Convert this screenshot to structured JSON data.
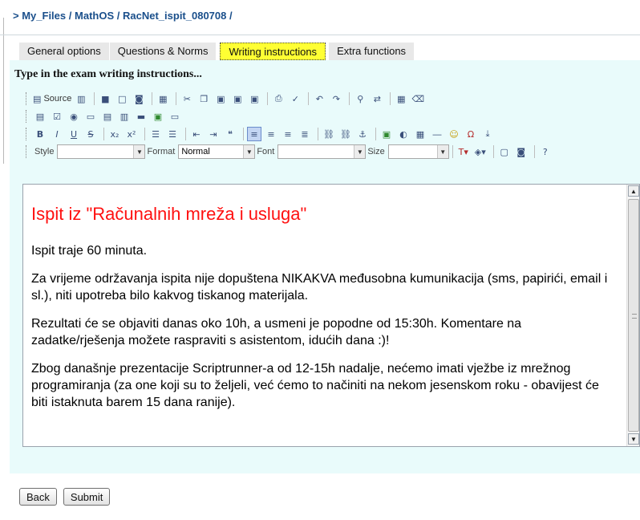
{
  "breadcrumb": {
    "prefix": ">",
    "items": [
      "My_Files",
      "MathOS",
      "RacNet_ispit_080708"
    ],
    "sep": "/"
  },
  "tabs": [
    {
      "label": "General options",
      "active": false
    },
    {
      "label": "Questions & Norms",
      "active": false
    },
    {
      "label": "Writing instructions",
      "active": true
    },
    {
      "label": "Extra functions",
      "active": false
    }
  ],
  "panel": {
    "title": "Type in the exam writing instructions..."
  },
  "toolbar": {
    "source_label": "Source",
    "style_label": "Style",
    "style_value": "",
    "format_label": "Format",
    "format_value": "Normal",
    "font_label": "Font",
    "font_value": "",
    "size_label": "Size",
    "size_value": ""
  },
  "editor": {
    "heading": "Ispit iz \"Računalnih mreža i usluga\"",
    "paragraphs": [
      "Ispit  traje 60 minuta.",
      "Za vrijeme održavanja ispita nije dopuštena NIKAKVA međusobna kumunikacija (sms, papirići, email i sl.), niti upotreba bilo kakvog tiskanog materijala.",
      "Rezultati će se objaviti danas oko 10h, a usmeni je popodne od 15:30h. Komentare na zadatke/rješenja možete raspraviti s asistentom, idućih dana :)!",
      "Zbog današnje prezentacije Scriptrunner-a od 12-15h nadalje, nećemo imati vježbe iz mrežnog programiranja (za one koji su to željeli, već ćemo to načiniti na nekom jesenskom roku - obavijest će  biti istaknuta barem 15 dana ranije)."
    ]
  },
  "buttons": {
    "back": "Back",
    "submit": "Submit"
  },
  "colors": {
    "heading": "#ff1010",
    "active_tab": "#ffff33",
    "panel_bg": "#e9fbfb",
    "link": "#1a4f8b"
  }
}
